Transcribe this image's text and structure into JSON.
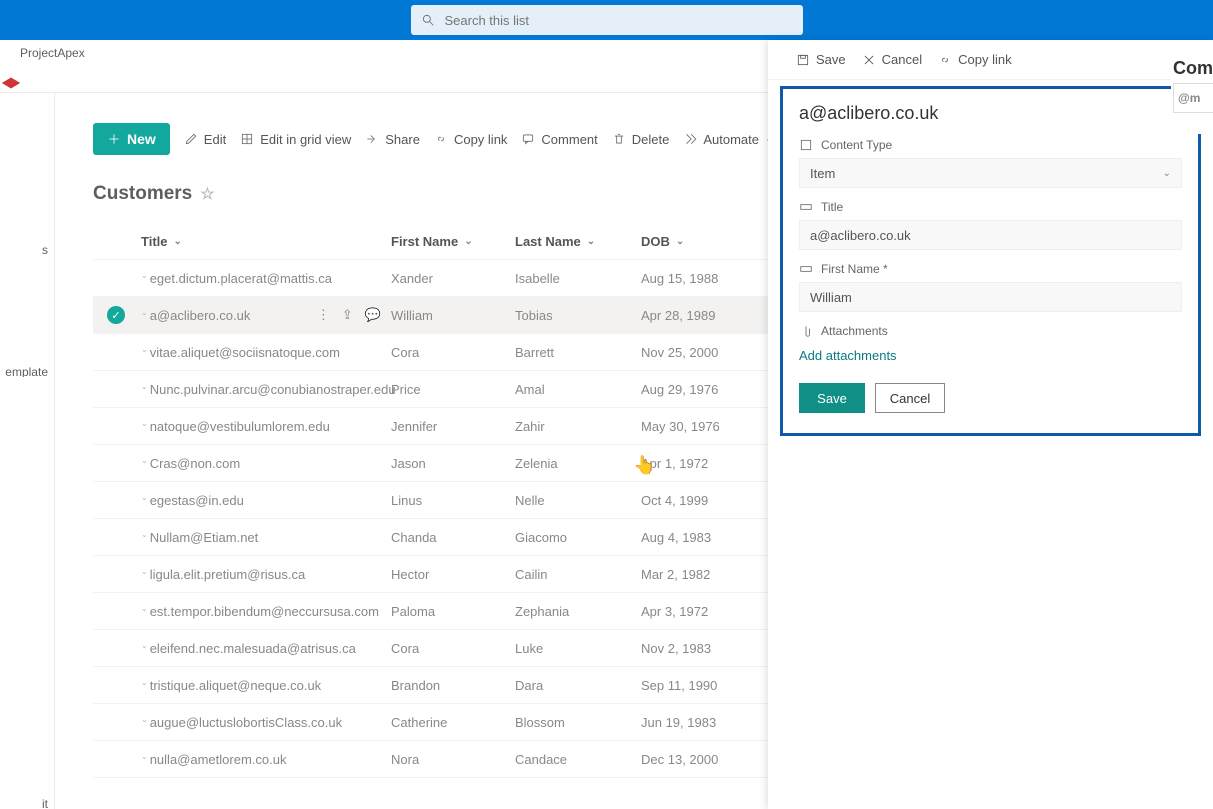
{
  "search": {
    "placeholder": "Search this list"
  },
  "site": {
    "name": "ProjectApex"
  },
  "left_rail": {
    "item1": "s",
    "item2": "emplate",
    "item3": "it"
  },
  "cmdbar": {
    "new": "New",
    "edit": "Edit",
    "grid": "Edit in grid view",
    "share": "Share",
    "copylink": "Copy link",
    "comment": "Comment",
    "delete": "Delete",
    "automate": "Automate",
    "more": "···"
  },
  "list": {
    "title": "Customers"
  },
  "columns": {
    "title": "Title",
    "first": "First Name",
    "last": "Last Name",
    "dob": "DOB"
  },
  "rows": [
    {
      "title": "eget.dictum.placerat@mattis.ca",
      "first": "Xander",
      "last": "Isabelle",
      "dob": "Aug 15, 1988"
    },
    {
      "title": "a@aclibero.co.uk",
      "first": "William",
      "last": "Tobias",
      "dob": "Apr 28, 1989"
    },
    {
      "title": "vitae.aliquet@sociisnatoque.com",
      "first": "Cora",
      "last": "Barrett",
      "dob": "Nov 25, 2000"
    },
    {
      "title": "Nunc.pulvinar.arcu@conubianostraper.edu",
      "first": "Price",
      "last": "Amal",
      "dob": "Aug 29, 1976"
    },
    {
      "title": "natoque@vestibulumlorem.edu",
      "first": "Jennifer",
      "last": "Zahir",
      "dob": "May 30, 1976"
    },
    {
      "title": "Cras@non.com",
      "first": "Jason",
      "last": "Zelenia",
      "dob": "Apr 1, 1972"
    },
    {
      "title": "egestas@in.edu",
      "first": "Linus",
      "last": "Nelle",
      "dob": "Oct 4, 1999"
    },
    {
      "title": "Nullam@Etiam.net",
      "first": "Chanda",
      "last": "Giacomo",
      "dob": "Aug 4, 1983"
    },
    {
      "title": "ligula.elit.pretium@risus.ca",
      "first": "Hector",
      "last": "Cailin",
      "dob": "Mar 2, 1982"
    },
    {
      "title": "est.tempor.bibendum@neccursusa.com",
      "first": "Paloma",
      "last": "Zephania",
      "dob": "Apr 3, 1972"
    },
    {
      "title": "eleifend.nec.malesuada@atrisus.ca",
      "first": "Cora",
      "last": "Luke",
      "dob": "Nov 2, 1983"
    },
    {
      "title": "tristique.aliquet@neque.co.uk",
      "first": "Brandon",
      "last": "Dara",
      "dob": "Sep 11, 1990"
    },
    {
      "title": "augue@luctuslobortisClass.co.uk",
      "first": "Catherine",
      "last": "Blossom",
      "dob": "Jun 19, 1983"
    },
    {
      "title": "nulla@ametlorem.co.uk",
      "first": "Nora",
      "last": "Candace",
      "dob": "Dec 13, 2000"
    }
  ],
  "panel_cmd": {
    "save": "Save",
    "cancel": "Cancel",
    "copylink": "Copy link"
  },
  "form": {
    "heading": "a@aclibero.co.uk",
    "content_type_label": "Content Type",
    "content_type_value": "Item",
    "title_label": "Title",
    "title_value": "a@aclibero.co.uk",
    "firstname_label": "First Name *",
    "firstname_value": "William",
    "attachments_label": "Attachments",
    "add_attachments": "Add attachments",
    "save": "Save",
    "cancel": "Cancel"
  },
  "comments": {
    "heading": "Com",
    "placeholder": "@m"
  }
}
